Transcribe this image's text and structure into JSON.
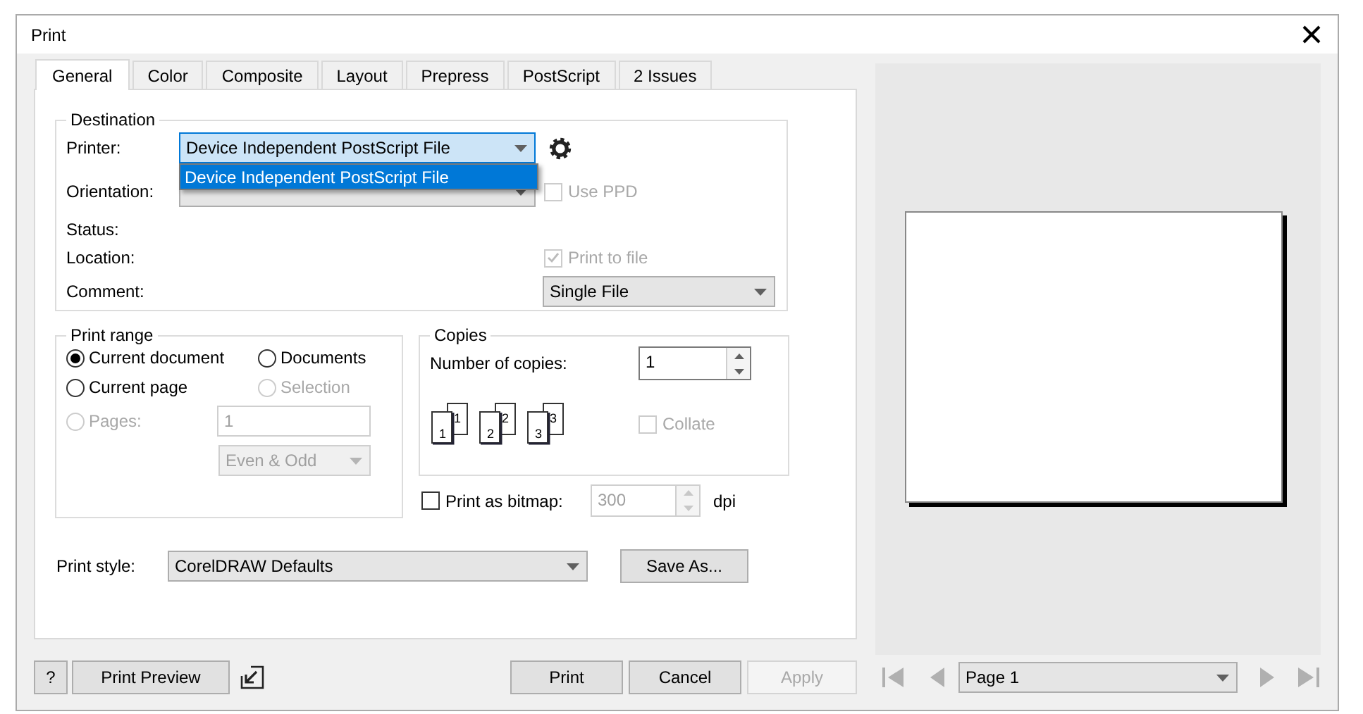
{
  "window": {
    "title": "Print"
  },
  "tabs": [
    {
      "label": "General",
      "selected": true
    },
    {
      "label": "Color",
      "selected": false
    },
    {
      "label": "Composite",
      "selected": false
    },
    {
      "label": "Layout",
      "selected": false
    },
    {
      "label": "Prepress",
      "selected": false
    },
    {
      "label": "PostScript",
      "selected": false
    },
    {
      "label": "2 Issues",
      "selected": false
    }
  ],
  "destination": {
    "title": "Destination",
    "printer": {
      "label": "Printer:",
      "value": "Device Independent PostScript File"
    },
    "printer_dropdown": [
      {
        "label": "Device Independent PostScript File",
        "selected": true
      }
    ],
    "orientation": {
      "label": "Orientation:"
    },
    "use_ppd": {
      "label": "Use PPD",
      "checked": false,
      "disabled": true
    },
    "status": {
      "label": "Status:"
    },
    "location": {
      "label": "Location:"
    },
    "print_to_file": {
      "label": "Print to file",
      "checked": true,
      "disabled": true
    },
    "comment": {
      "label": "Comment:"
    },
    "file_mode": {
      "value": "Single File"
    }
  },
  "print_range": {
    "title": "Print range",
    "options": [
      {
        "label": "Current document",
        "selected": true,
        "disabled": false
      },
      {
        "label": "Documents",
        "selected": false,
        "disabled": false
      },
      {
        "label": "Current page",
        "selected": false,
        "disabled": false
      },
      {
        "label": "Selection",
        "selected": false,
        "disabled": true
      },
      {
        "label": "Pages:",
        "selected": false,
        "disabled": true
      }
    ],
    "pages": {
      "value": "1"
    },
    "parity": {
      "value": "Even & Odd"
    }
  },
  "copies": {
    "title": "Copies",
    "label": "Number of copies:",
    "value": "1",
    "collate_pages": [
      "1",
      "1",
      "2",
      "2",
      "3",
      "3"
    ],
    "collate": {
      "label": "Collate",
      "checked": false,
      "disabled": true
    }
  },
  "bitmap": {
    "label": "Print as bitmap:",
    "checked": false,
    "value": "300",
    "unit": "dpi"
  },
  "print_style": {
    "label": "Print style:",
    "value": "CorelDRAW Defaults",
    "save_button": "Save As..."
  },
  "left_buttons": [
    "?",
    "Print Preview"
  ],
  "actions": [
    {
      "label": "Print",
      "disabled": false
    },
    {
      "label": "Cancel",
      "disabled": false
    },
    {
      "label": "Apply",
      "disabled": true
    }
  ],
  "preview": {
    "page_selector": "Page 1"
  }
}
